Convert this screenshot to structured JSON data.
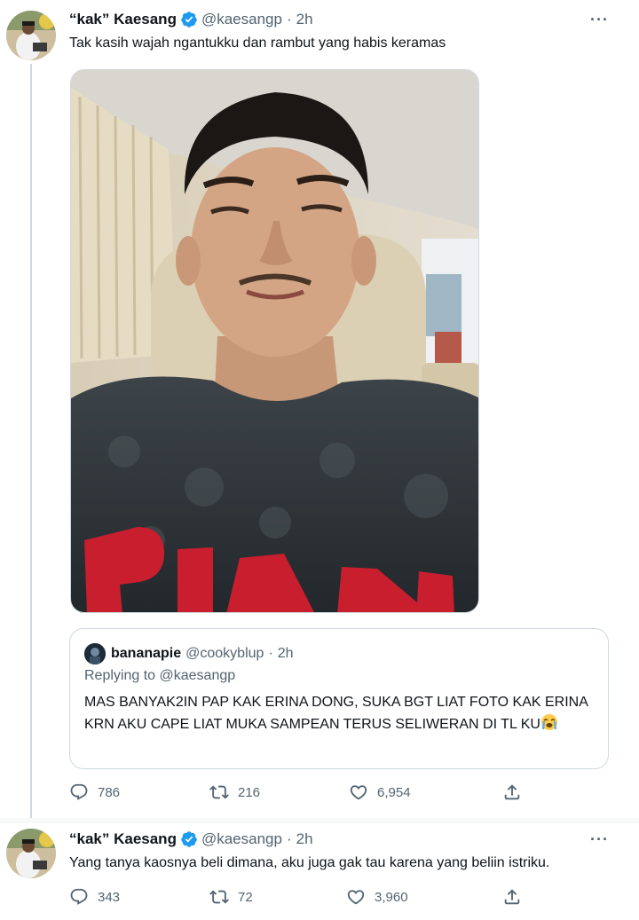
{
  "tweets": [
    {
      "display_name": "“kak” Kaesang",
      "handle": "@kaesangp",
      "separator": "·",
      "time": "2h",
      "more": "···",
      "text": "Tak kasih wajah ngantukku dan rambut yang habis keramas",
      "quoted": {
        "display_name": "bananapie",
        "handle": "@cookyblup",
        "separator": "·",
        "time": "2h",
        "replying_prefix": "Replying to ",
        "replying_to": "@kaesangp",
        "text": "MAS BANYAK2IN PAP KAK ERINA DONG, SUKA BGT LIAT FOTO KAK ERINA KRN AKU CAPE LIAT MUKA SAMPEAN TERUS SELIWERAN DI TL KU"
      },
      "stats": {
        "replies": "786",
        "retweets": "216",
        "likes": "6,954"
      }
    },
    {
      "display_name": "“kak” Kaesang",
      "handle": "@kaesangp",
      "separator": "·",
      "time": "2h",
      "more": "···",
      "text": "Yang tanya kaosnya beli dimana, aku juga gak tau karena yang beliin istriku.",
      "stats": {
        "replies": "343",
        "retweets": "72",
        "likes": "3,960"
      }
    }
  ],
  "icons": {
    "verified": "verified-badge-icon",
    "reply": "reply-icon",
    "retweet": "retweet-icon",
    "like": "heart-icon",
    "share": "share-icon",
    "more": "more-icon",
    "crying": "loudly-crying-face-emoji"
  },
  "colors": {
    "verified_blue": "#1d9bf0",
    "text": "#0f1419",
    "secondary": "#536471",
    "border": "#cfd9de"
  }
}
